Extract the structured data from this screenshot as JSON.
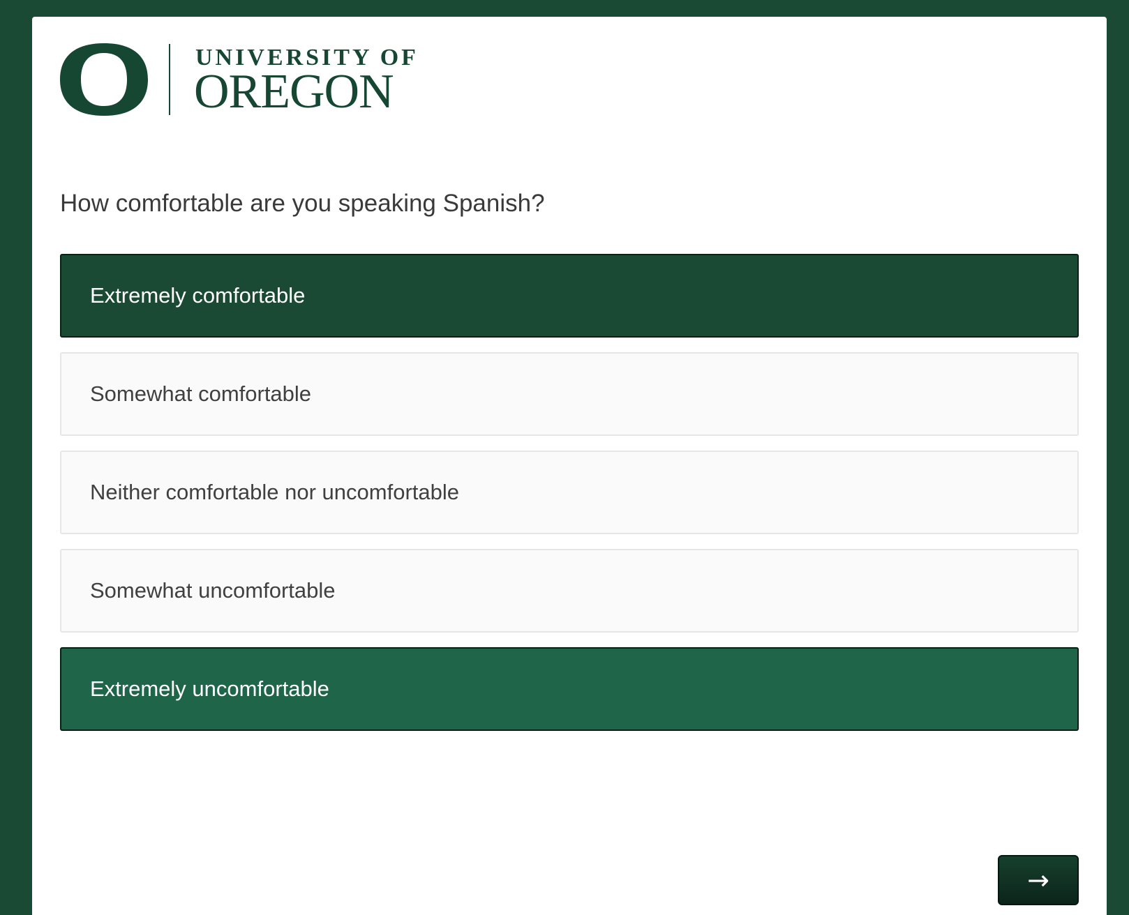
{
  "header": {
    "logo_line1": "UNIVERSITY OF",
    "logo_line2": "OREGON"
  },
  "question": {
    "text": "How comfortable are you speaking Spanish?"
  },
  "choices": [
    {
      "label": "Extremely comfortable",
      "state": "selected"
    },
    {
      "label": "Somewhat comfortable",
      "state": "default"
    },
    {
      "label": "Neither comfortable nor uncomfortable",
      "state": "default"
    },
    {
      "label": "Somewhat uncomfortable",
      "state": "default"
    },
    {
      "label": "Extremely uncomfortable",
      "state": "hovered"
    }
  ],
  "navigation": {
    "next_label": "→"
  },
  "colors": {
    "brand_green": "#154733",
    "page_background": "#1a4a34",
    "selected_choice": "#1a4a34",
    "hovered_choice": "#1f654a",
    "unselected_choice": "#fafafa"
  }
}
